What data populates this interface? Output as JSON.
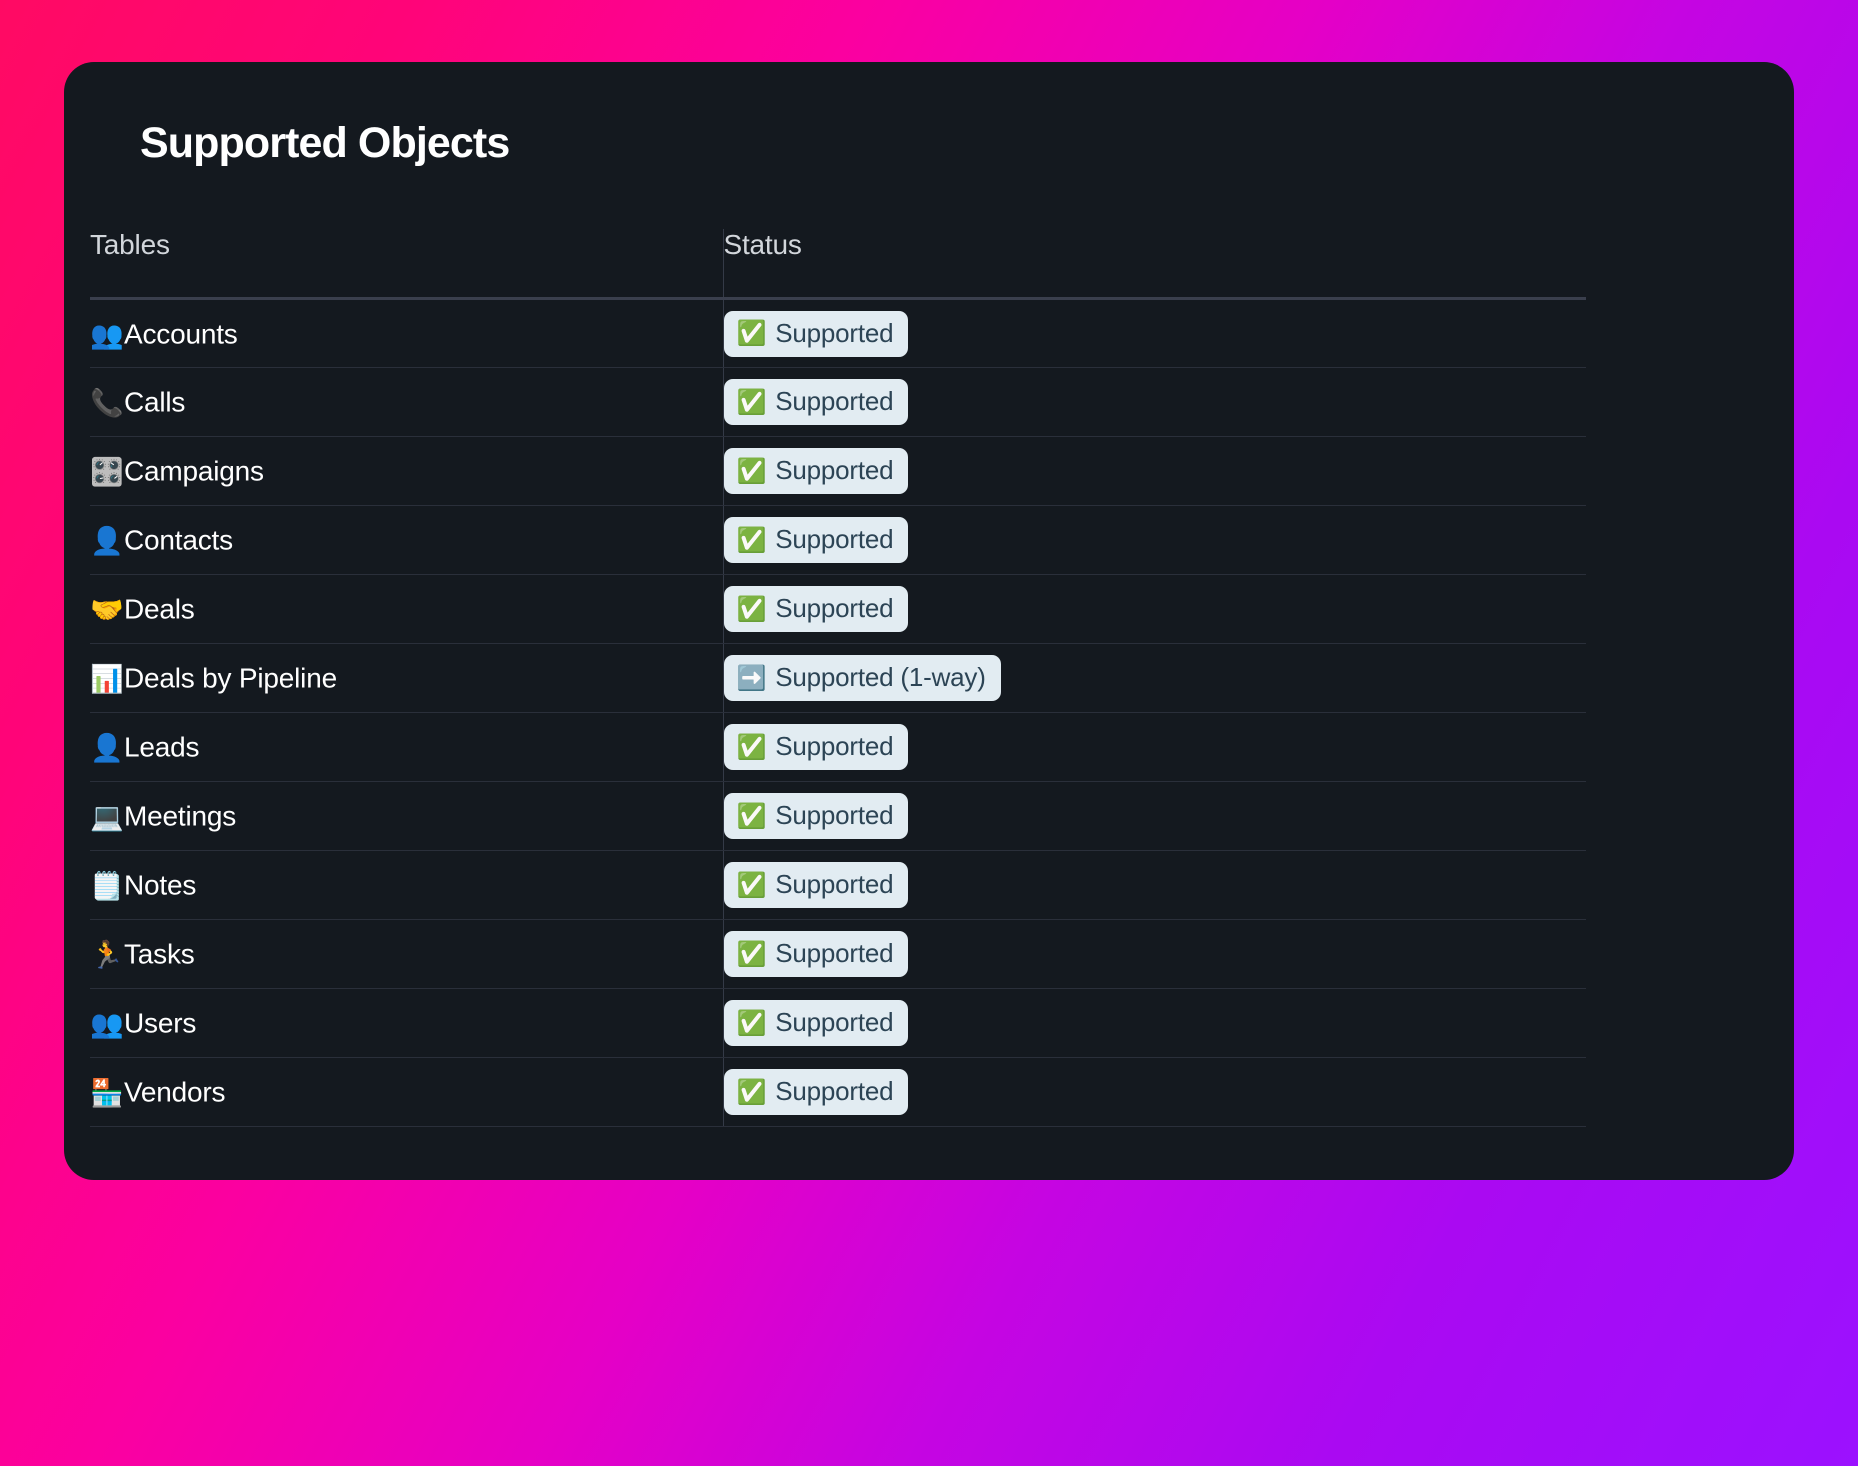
{
  "card": {
    "title": "Supported Objects"
  },
  "table": {
    "columns": [
      {
        "key": "name",
        "label": "Tables"
      },
      {
        "key": "status",
        "label": "Status"
      }
    ],
    "rows": [
      {
        "emoji": "👥",
        "emoji_name": "busts-in-silhouette-icon",
        "name": "Accounts",
        "status_emoji": "✅",
        "status_emoji_name": "check-mark-button-icon",
        "status": "Supported"
      },
      {
        "emoji": "📞",
        "emoji_name": "telephone-receiver-icon",
        "name": "Calls",
        "status_emoji": "✅",
        "status_emoji_name": "check-mark-button-icon",
        "status": "Supported"
      },
      {
        "emoji": "🎛️",
        "emoji_name": "control-knobs-icon",
        "name": "Campaigns",
        "status_emoji": "✅",
        "status_emoji_name": "check-mark-button-icon",
        "status": "Supported"
      },
      {
        "emoji": "👤",
        "emoji_name": "bust-in-silhouette-icon",
        "name": "Contacts",
        "status_emoji": "✅",
        "status_emoji_name": "check-mark-button-icon",
        "status": "Supported"
      },
      {
        "emoji": "🤝",
        "emoji_name": "handshake-icon",
        "name": "Deals",
        "status_emoji": "✅",
        "status_emoji_name": "check-mark-button-icon",
        "status": "Supported"
      },
      {
        "emoji": "📊",
        "emoji_name": "bar-chart-icon",
        "name": "Deals by Pipeline",
        "status_emoji": "➡️",
        "status_emoji_name": "right-arrow-icon",
        "status": "Supported (1-way)"
      },
      {
        "emoji": "👤",
        "emoji_name": "bust-in-silhouette-icon",
        "name": "Leads",
        "status_emoji": "✅",
        "status_emoji_name": "check-mark-button-icon",
        "status": "Supported"
      },
      {
        "emoji": "💻",
        "emoji_name": "laptop-icon",
        "name": "Meetings",
        "status_emoji": "✅",
        "status_emoji_name": "check-mark-button-icon",
        "status": "Supported"
      },
      {
        "emoji": "🗒️",
        "emoji_name": "spiral-notepad-icon",
        "name": "Notes",
        "status_emoji": "✅",
        "status_emoji_name": "check-mark-button-icon",
        "status": "Supported"
      },
      {
        "emoji": "🏃",
        "emoji_name": "person-running-icon",
        "name": "Tasks",
        "status_emoji": "✅",
        "status_emoji_name": "check-mark-button-icon",
        "status": "Supported"
      },
      {
        "emoji": "👥",
        "emoji_name": "busts-in-silhouette-icon",
        "name": "Users",
        "status_emoji": "✅",
        "status_emoji_name": "check-mark-button-icon",
        "status": "Supported"
      },
      {
        "emoji": "🏪",
        "emoji_name": "convenience-store-icon",
        "name": "Vendors",
        "status_emoji": "✅",
        "status_emoji_name": "check-mark-button-icon",
        "status": "Supported"
      }
    ]
  },
  "colors": {
    "card_background": "#14191f",
    "gradient_start": "#ff0a63",
    "gradient_mid": "#e500c6",
    "gradient_end": "#9b11ff",
    "badge_background": "#e2ecf2",
    "badge_text": "#2c4455",
    "header_text": "#d2d6db",
    "row_text": "#ffffff",
    "divider": "#2a2f3a"
  }
}
